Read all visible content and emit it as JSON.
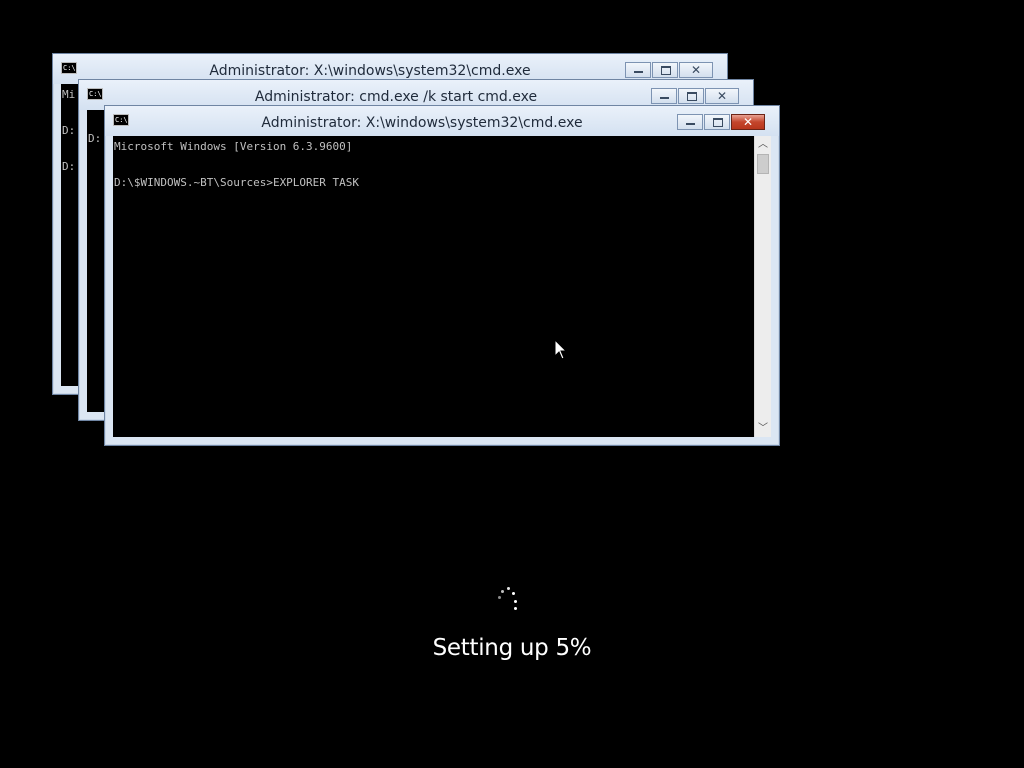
{
  "windows": {
    "back": {
      "title": "Administrator: X:\\windows\\system32\\cmd.exe",
      "icon_label": "C:\\",
      "visible_lines": [
        "Mi",
        "",
        "D:",
        "",
        "D:"
      ]
    },
    "middle": {
      "title": "Administrator: cmd.exe /k start cmd.exe",
      "icon_label": "C:\\",
      "visible_lines": [
        "",
        "D:"
      ]
    },
    "front": {
      "title": "Administrator: X:\\windows\\system32\\cmd.exe",
      "icon_label": "C:\\",
      "console_lines": [
        "Microsoft Windows [Version 6.3.9600]",
        "",
        "D:\\$WINDOWS.~BT\\Sources>EXPLORER TASK"
      ]
    }
  },
  "window_buttons": {
    "minimize": "minimize-icon",
    "maximize": "maximize-icon",
    "close": "✕"
  },
  "scrollbar": {
    "up_arrow": "︿",
    "down_arrow": "﹀"
  },
  "setup": {
    "status": "Setting up 5%",
    "progress_percent": 5
  },
  "colors": {
    "desktop_background": "#000000",
    "console_background": "#000000",
    "console_text": "#c0c0c0",
    "window_frame": "#dbe6f3",
    "close_button_active": "#c4452c"
  }
}
